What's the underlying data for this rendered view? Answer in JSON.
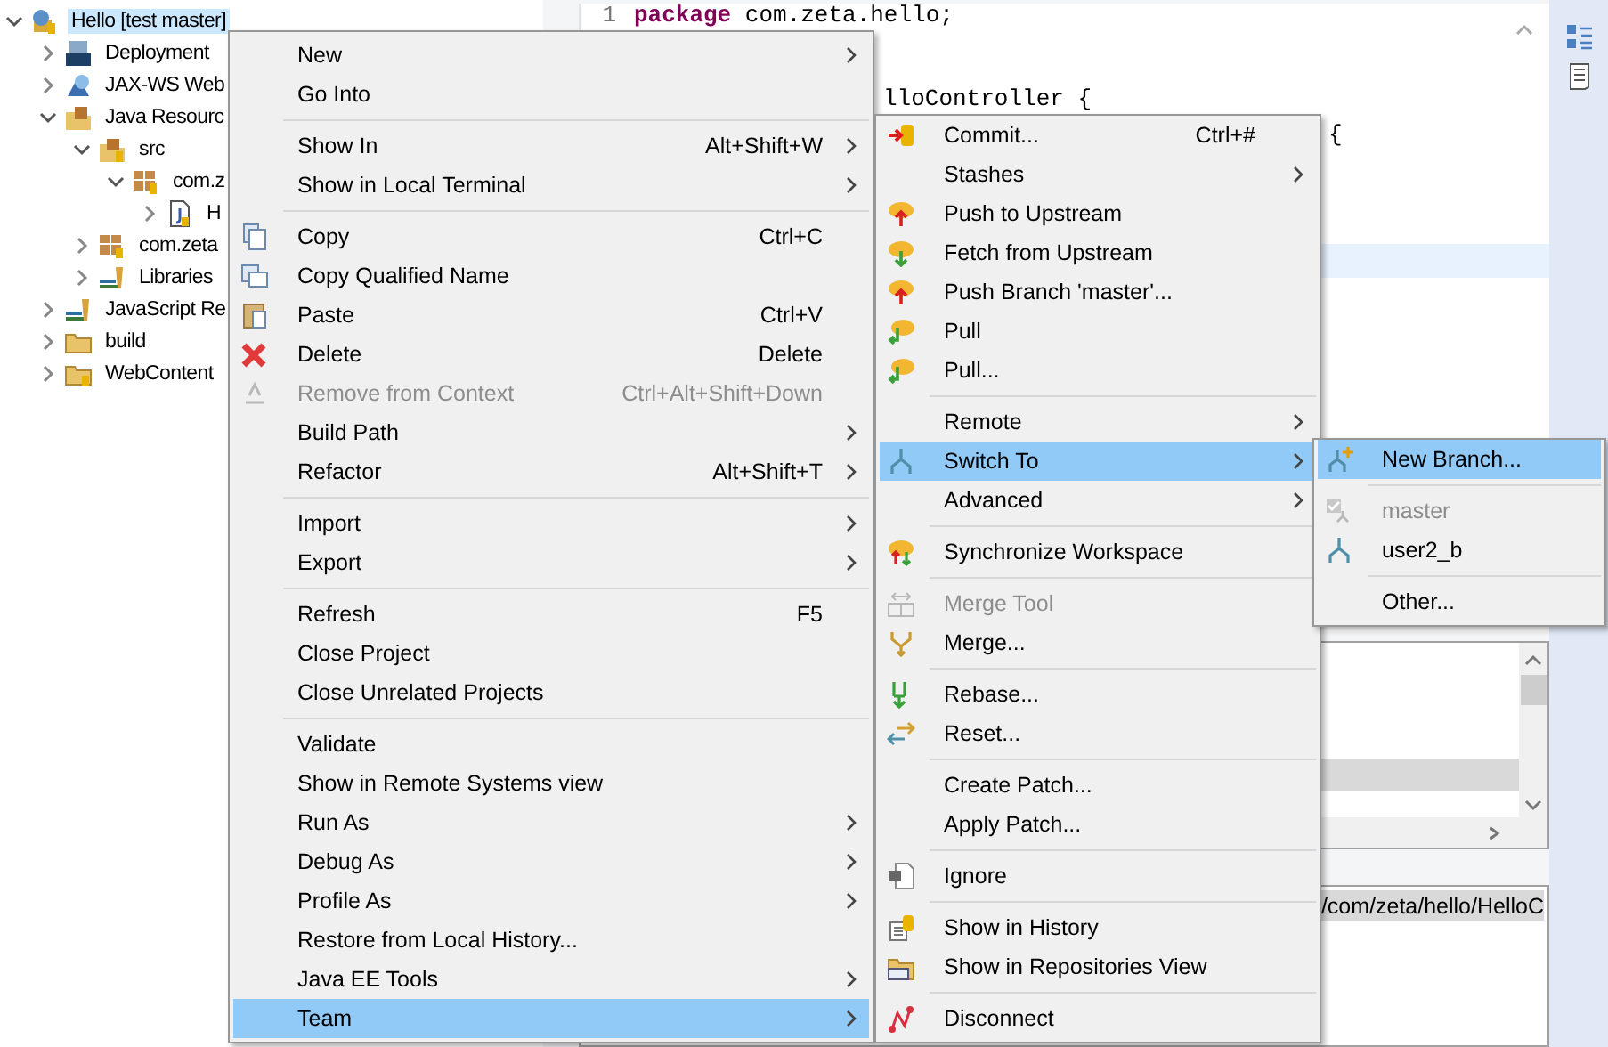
{
  "project_tree": {
    "items": [
      {
        "label": "Hello [test master]",
        "expanded": true,
        "selected": true,
        "children": [
          {
            "label": "Deployment",
            "expanded": false,
            "selected": false
          },
          {
            "label": "JAX-WS Web",
            "expanded": false,
            "selected": false
          },
          {
            "label": "Java Resourc",
            "expanded": true,
            "selected": false,
            "children": [
              {
                "label": "src",
                "expanded": true,
                "selected": false,
                "children": [
                  {
                    "label": "com.z",
                    "expanded": true,
                    "selected": false,
                    "children": [
                      {
                        "label": "H",
                        "expanded": false,
                        "selected": false
                      }
                    ]
                  }
                ]
              },
              {
                "label": "com.zeta",
                "expanded": false,
                "selected": false
              },
              {
                "label": "Libraries",
                "expanded": false,
                "selected": false
              }
            ]
          },
          {
            "label": "JavaScript Re",
            "expanded": false,
            "selected": false
          },
          {
            "label": "build",
            "expanded": false,
            "selected": false
          },
          {
            "label": "WebContent",
            "expanded": false,
            "selected": false
          }
        ]
      }
    ]
  },
  "editor": {
    "lines": [
      {
        "number": "1",
        "text": "**package** com.zeta.hello;",
        "current": false
      },
      {
        "text": "lloController {",
        "current": false
      },
      {
        "text": "{",
        "current": false
      },
      {
        "current": true
      }
    ]
  },
  "middle_panel": {
    "rows": [
      {
        "selected": true
      }
    ]
  },
  "bottom_panel": {
    "rows": [
      {
        "text": "/com/zeta/hello/HelloC",
        "selected": true
      }
    ]
  },
  "context_menu": {
    "items": [
      {
        "kind": "item",
        "label": "New",
        "has_submenu": true,
        "disabled": false,
        "selected": false
      },
      {
        "kind": "item",
        "label": "Go Into",
        "has_submenu": false,
        "disabled": false,
        "selected": false
      },
      {
        "kind": "separator"
      },
      {
        "kind": "item",
        "label": "Show In",
        "shortcut": "Alt+Shift+W",
        "has_submenu": true,
        "disabled": false,
        "selected": false
      },
      {
        "kind": "item",
        "label": "Show in Local Terminal",
        "has_submenu": true,
        "disabled": false,
        "selected": false
      },
      {
        "kind": "separator"
      },
      {
        "kind": "item",
        "label": "Copy",
        "shortcut": "Ctrl+C",
        "has_submenu": false,
        "disabled": false,
        "selected": false
      },
      {
        "kind": "item",
        "label": "Copy Qualified Name",
        "has_submenu": false,
        "disabled": false,
        "selected": false
      },
      {
        "kind": "item",
        "label": "Paste",
        "shortcut": "Ctrl+V",
        "has_submenu": false,
        "disabled": false,
        "selected": false
      },
      {
        "kind": "item",
        "label": "Delete",
        "shortcut": "Delete",
        "has_submenu": false,
        "disabled": false,
        "selected": false
      },
      {
        "kind": "item",
        "label": "Remove from Context",
        "shortcut": "Ctrl+Alt+Shift+Down",
        "has_submenu": false,
        "disabled": true,
        "selected": false
      },
      {
        "kind": "item",
        "label": "Build Path",
        "has_submenu": true,
        "disabled": false,
        "selected": false
      },
      {
        "kind": "item",
        "label": "Refactor",
        "shortcut": "Alt+Shift+T",
        "has_submenu": true,
        "disabled": false,
        "selected": false
      },
      {
        "kind": "separator"
      },
      {
        "kind": "item",
        "label": "Import",
        "has_submenu": true,
        "disabled": false,
        "selected": false
      },
      {
        "kind": "item",
        "label": "Export",
        "has_submenu": true,
        "disabled": false,
        "selected": false
      },
      {
        "kind": "separator"
      },
      {
        "kind": "item",
        "label": "Refresh",
        "shortcut": "F5",
        "has_submenu": false,
        "disabled": false,
        "selected": false
      },
      {
        "kind": "item",
        "label": "Close Project",
        "has_submenu": false,
        "disabled": false,
        "selected": false
      },
      {
        "kind": "item",
        "label": "Close Unrelated Projects",
        "has_submenu": false,
        "disabled": false,
        "selected": false
      },
      {
        "kind": "separator"
      },
      {
        "kind": "item",
        "label": "Validate",
        "has_submenu": false,
        "disabled": false,
        "selected": false
      },
      {
        "kind": "item",
        "label": "Show in Remote Systems view",
        "has_submenu": false,
        "disabled": false,
        "selected": false
      },
      {
        "kind": "item",
        "label": "Run As",
        "has_submenu": true,
        "disabled": false,
        "selected": false
      },
      {
        "kind": "item",
        "label": "Debug As",
        "has_submenu": true,
        "disabled": false,
        "selected": false
      },
      {
        "kind": "item",
        "label": "Profile As",
        "has_submenu": true,
        "disabled": false,
        "selected": false
      },
      {
        "kind": "item",
        "label": "Restore from Local History...",
        "has_submenu": false,
        "disabled": false,
        "selected": false
      },
      {
        "kind": "item",
        "label": "Java EE Tools",
        "has_submenu": true,
        "disabled": false,
        "selected": false
      },
      {
        "kind": "item",
        "label": "Team",
        "has_submenu": true,
        "disabled": false,
        "selected": true
      }
    ]
  },
  "team_submenu": {
    "items": [
      {
        "kind": "item",
        "label": "Commit...",
        "shortcut": "Ctrl+#",
        "has_submenu": false,
        "disabled": false,
        "selected": false
      },
      {
        "kind": "item",
        "label": "Stashes",
        "has_submenu": true,
        "disabled": false,
        "selected": false
      },
      {
        "kind": "item",
        "label": "Push to Upstream",
        "has_submenu": false,
        "disabled": false,
        "selected": false
      },
      {
        "kind": "item",
        "label": "Fetch from Upstream",
        "has_submenu": false,
        "disabled": false,
        "selected": false
      },
      {
        "kind": "item",
        "label": "Push Branch 'master'...",
        "has_submenu": false,
        "disabled": false,
        "selected": false
      },
      {
        "kind": "item",
        "label": "Pull",
        "has_submenu": false,
        "disabled": false,
        "selected": false
      },
      {
        "kind": "item",
        "label": "Pull...",
        "has_submenu": false,
        "disabled": false,
        "selected": false
      },
      {
        "kind": "separator"
      },
      {
        "kind": "item",
        "label": "Remote",
        "has_submenu": true,
        "disabled": false,
        "selected": false
      },
      {
        "kind": "item",
        "label": "Switch To",
        "has_submenu": true,
        "disabled": false,
        "selected": true
      },
      {
        "kind": "item",
        "label": "Advanced",
        "has_submenu": true,
        "disabled": false,
        "selected": false
      },
      {
        "kind": "separator"
      },
      {
        "kind": "item",
        "label": "Synchronize Workspace",
        "has_submenu": false,
        "disabled": false,
        "selected": false
      },
      {
        "kind": "separator"
      },
      {
        "kind": "item",
        "label": "Merge Tool",
        "has_submenu": false,
        "disabled": true,
        "selected": false
      },
      {
        "kind": "item",
        "label": "Merge...",
        "has_submenu": false,
        "disabled": false,
        "selected": false
      },
      {
        "kind": "separator"
      },
      {
        "kind": "item",
        "label": "Rebase...",
        "has_submenu": false,
        "disabled": false,
        "selected": false
      },
      {
        "kind": "item",
        "label": "Reset...",
        "has_submenu": false,
        "disabled": false,
        "selected": false
      },
      {
        "kind": "separator"
      },
      {
        "kind": "item",
        "label": "Create Patch...",
        "has_submenu": false,
        "disabled": false,
        "selected": false
      },
      {
        "kind": "item",
        "label": "Apply Patch...",
        "has_submenu": false,
        "disabled": false,
        "selected": false
      },
      {
        "kind": "separator"
      },
      {
        "kind": "item",
        "label": "Ignore",
        "has_submenu": false,
        "disabled": false,
        "selected": false
      },
      {
        "kind": "separator"
      },
      {
        "kind": "item",
        "label": "Show in History",
        "has_submenu": false,
        "disabled": false,
        "selected": false
      },
      {
        "kind": "item",
        "label": "Show in Repositories View",
        "has_submenu": false,
        "disabled": false,
        "selected": false
      },
      {
        "kind": "separator"
      },
      {
        "kind": "item",
        "label": "Disconnect",
        "has_submenu": false,
        "disabled": false,
        "selected": false
      }
    ]
  },
  "switch_to_submenu": {
    "items": [
      {
        "kind": "item",
        "label": "New Branch...",
        "has_submenu": false,
        "disabled": false,
        "selected": true
      },
      {
        "kind": "separator"
      },
      {
        "kind": "item",
        "label": "master",
        "has_submenu": false,
        "disabled": true,
        "selected": false
      },
      {
        "kind": "item",
        "label": "user2_b",
        "has_submenu": false,
        "disabled": false,
        "selected": false
      },
      {
        "kind": "separator"
      },
      {
        "kind": "item",
        "label": "Other...",
        "has_submenu": false,
        "disabled": false,
        "selected": false
      }
    ]
  }
}
